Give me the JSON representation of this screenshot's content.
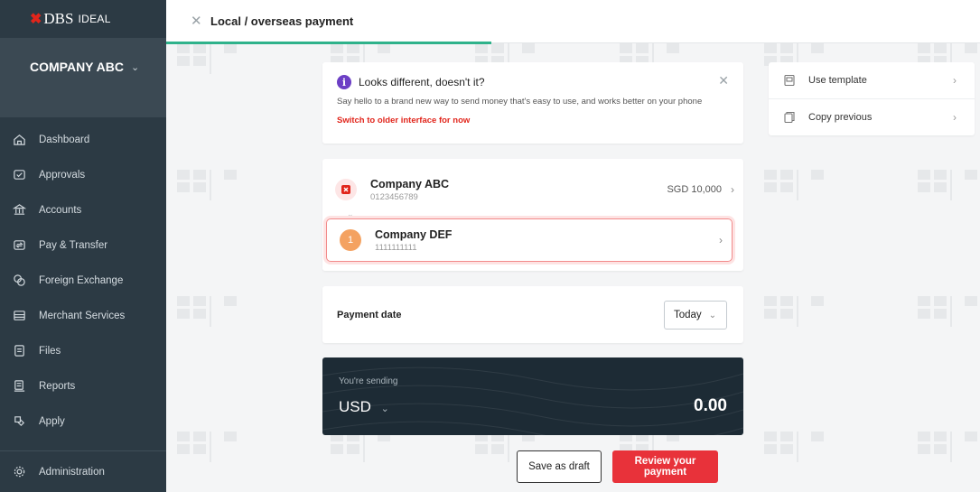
{
  "brand": {
    "x_mark": "✖",
    "name": "DBS",
    "product": "IDEAL"
  },
  "company": {
    "name": "COMPANY ABC"
  },
  "nav": [
    {
      "label": "Dashboard",
      "icon": "home-icon"
    },
    {
      "label": "Approvals",
      "icon": "approvals-icon"
    },
    {
      "label": "Accounts",
      "icon": "bank-icon"
    },
    {
      "label": "Pay & Transfer",
      "icon": "transfer-icon"
    },
    {
      "label": "Foreign Exchange",
      "icon": "currency-exchange-icon"
    },
    {
      "label": "Merchant Services",
      "icon": "storefront-icon"
    },
    {
      "label": "Files",
      "icon": "file-icon"
    },
    {
      "label": "Reports",
      "icon": "report-icon"
    },
    {
      "label": "Apply",
      "icon": "apply-icon"
    }
  ],
  "admin": {
    "label": "Administration",
    "icon": "gear-icon"
  },
  "header": {
    "title": "Local / overseas payment",
    "progress": 0.4
  },
  "notice": {
    "title": "Looks different, doesn't it?",
    "description": "Say hello to a brand new way to send money that's easy to use, and works better on your phone",
    "link": "Switch to older interface for now"
  },
  "quick_actions": [
    {
      "label": "Use template",
      "icon": "template-icon"
    },
    {
      "label": "Copy previous",
      "icon": "copy-icon"
    }
  ],
  "from": {
    "name": "Company ABC",
    "account": "0123456789",
    "balance": "SGD 10,000"
  },
  "to": {
    "index": "1",
    "name": "Company DEF",
    "account": "1111111111"
  },
  "payment_date": {
    "label": "Payment date",
    "value": "Today"
  },
  "sending": {
    "label": "You're sending",
    "currency": "USD",
    "amount": "0.00"
  },
  "actions": {
    "draft": "Save as draft",
    "review": "Review your payment"
  },
  "colors": {
    "sidebar": "#2c3a44",
    "accent_red": "#e8323a",
    "progress_green": "#2fb28b",
    "info_purple": "#6c3fc5"
  }
}
